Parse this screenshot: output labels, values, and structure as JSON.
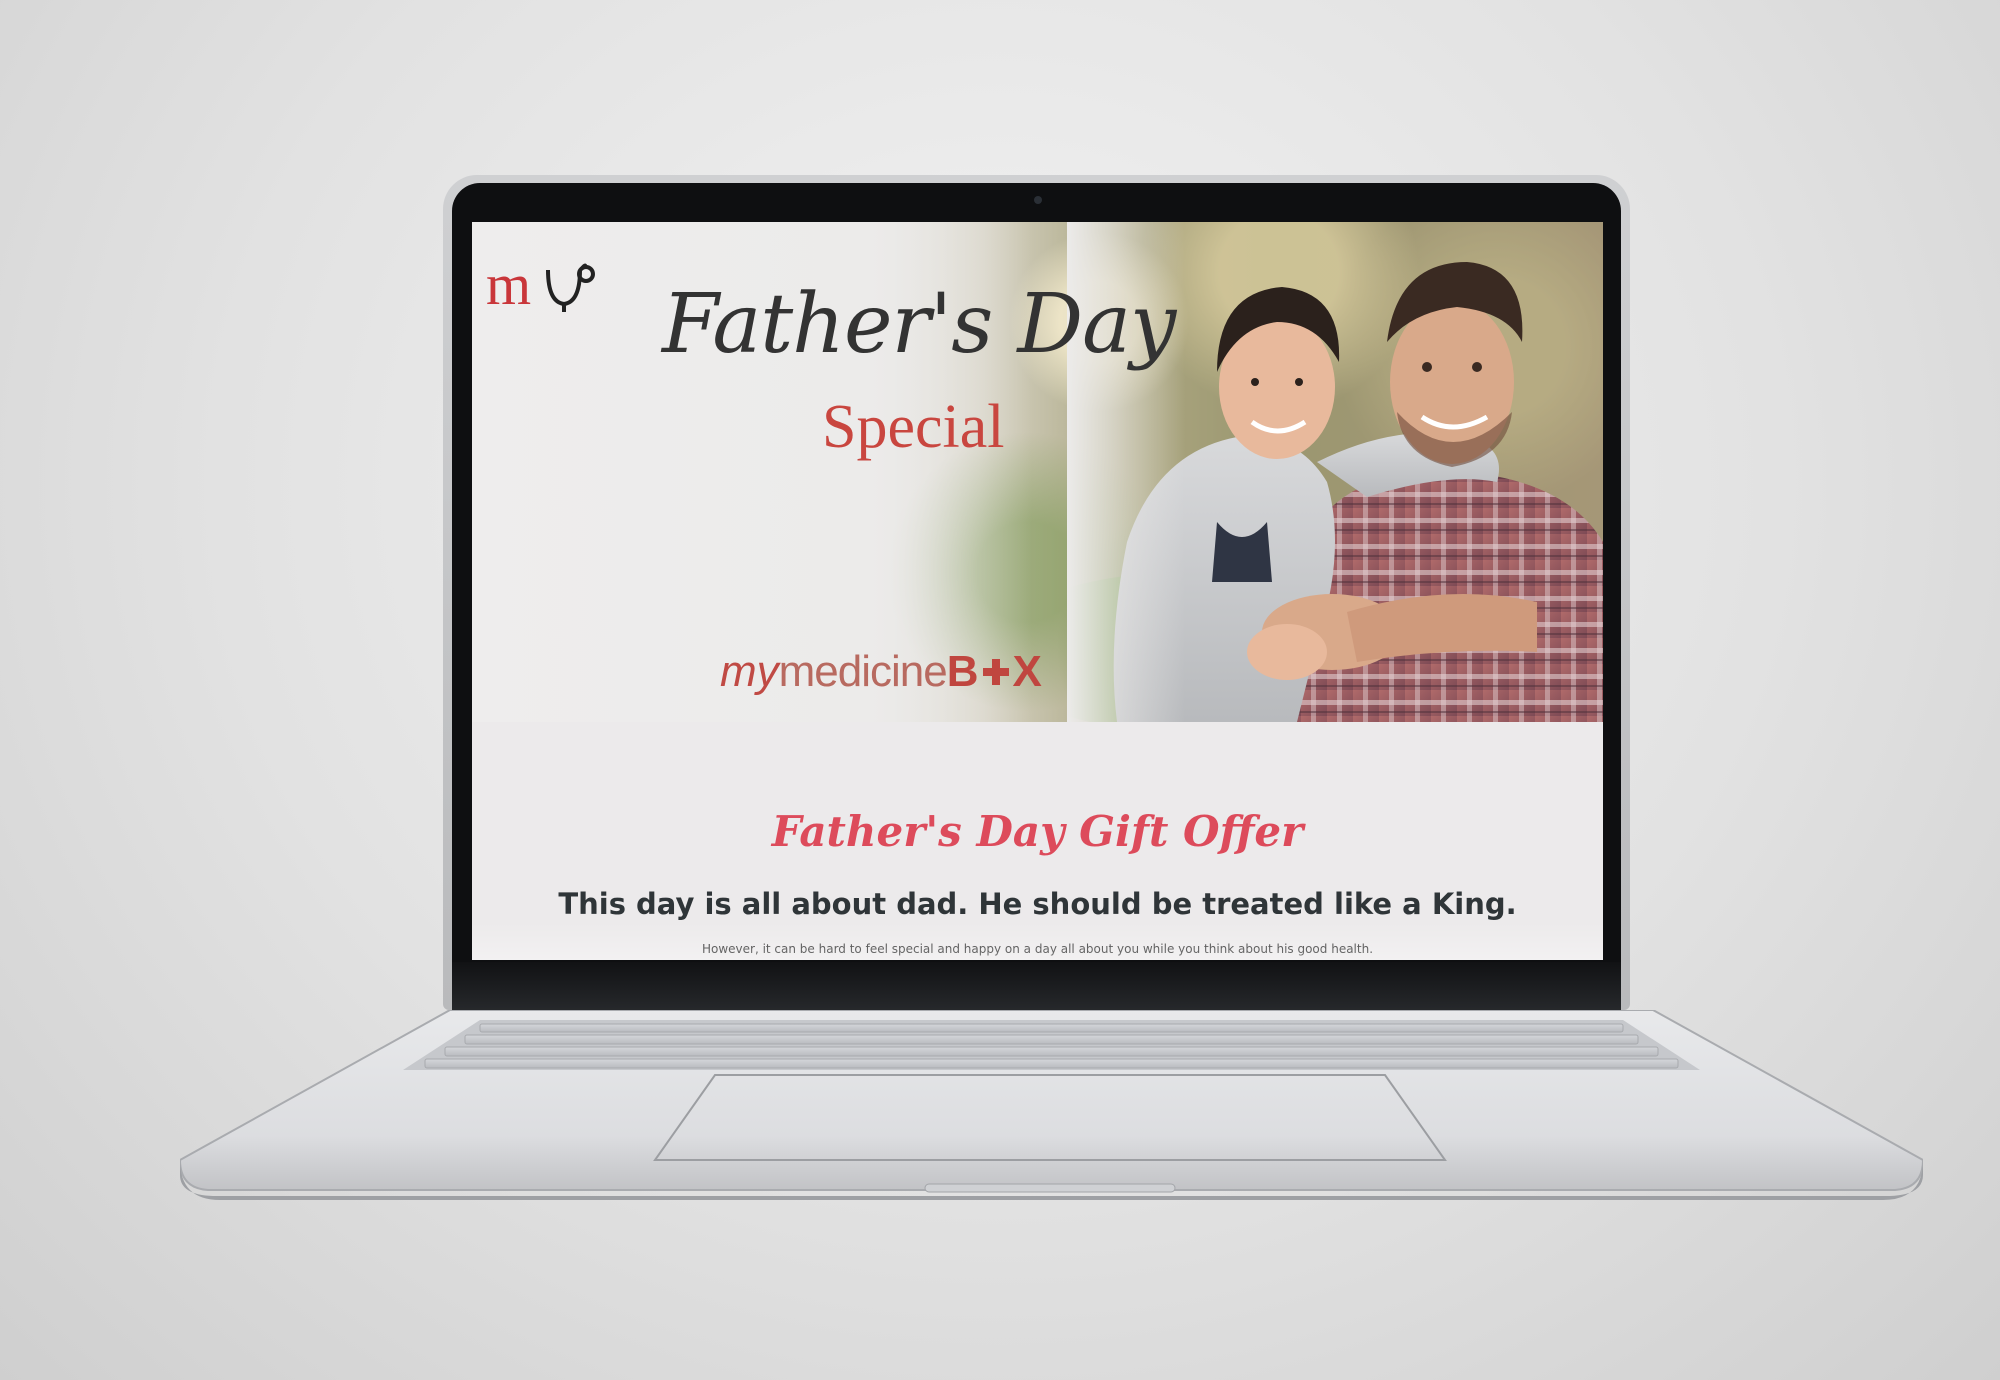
{
  "hero": {
    "title": "Father's Day",
    "subtitle": "Special",
    "brand": {
      "my": "my",
      "medicine": "medicine",
      "box_b": "B",
      "box_x": "X"
    },
    "logo_letters": "m"
  },
  "offer": {
    "title": "Father's Day Gift Offer",
    "headline": "This day is all about dad. He should be treated like a King.",
    "body": "However, it can be hard to feel special and happy on a day all about you while you think about his good health."
  },
  "colors": {
    "accent_red": "#dd4b5b",
    "brand_red": "#c0463f",
    "text_dark": "#2f3538"
  },
  "icons": {
    "logo": "stethoscope-my-logo",
    "brand_cross": "plus-cross-icon"
  }
}
